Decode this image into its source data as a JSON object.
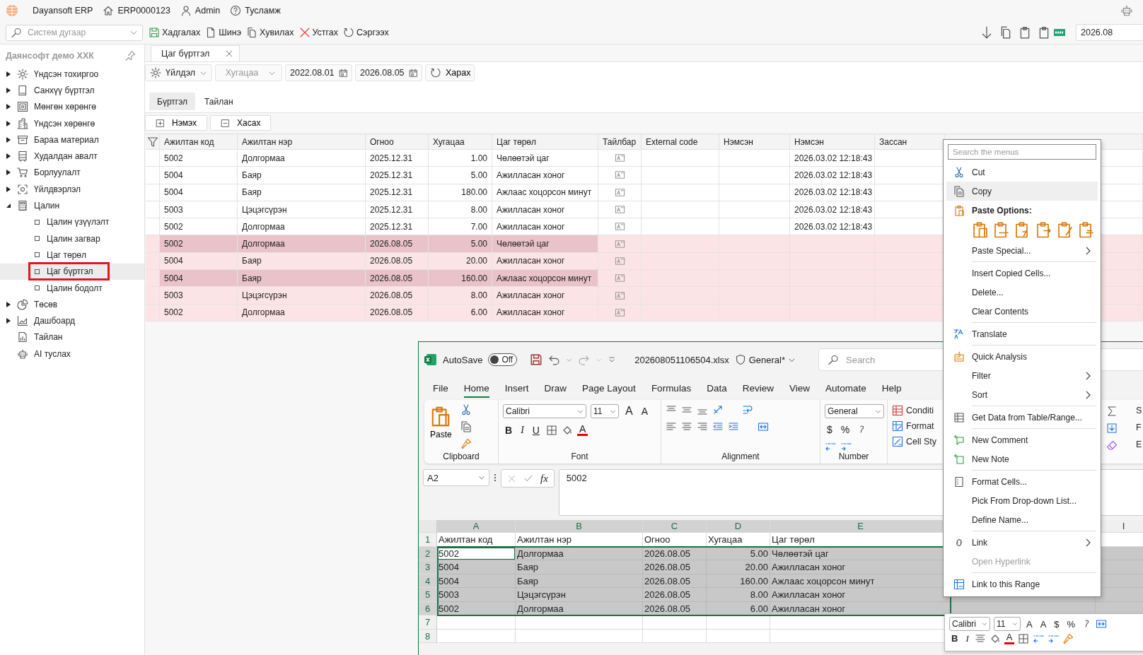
{
  "topbar": {
    "app": "Dayansoft ERP",
    "record": "ERP0000123",
    "user": "Admin",
    "help": "Тусламж"
  },
  "toolbar": {
    "search": {
      "placeholder": "Систем дугаар"
    },
    "actions": [
      {
        "kind": "save",
        "label": "Хадгалах"
      },
      {
        "kind": "new",
        "label": "Шинэ"
      },
      {
        "kind": "duplicate",
        "label": "Хувилах"
      },
      {
        "kind": "delete",
        "label": "Устгах"
      },
      {
        "kind": "restore",
        "label": "Сэргээх"
      }
    ],
    "date": "2026.08"
  },
  "sidebar": {
    "company": "Даянсофт демо ХХК",
    "items": [
      {
        "kind": "gear",
        "label": "Үндсэн тохиргоо",
        "expanded": false
      },
      {
        "kind": "book",
        "label": "Санхүү бүртгэл",
        "expanded": false
      },
      {
        "kind": "safe",
        "label": "Мөнгөн хөрөнгө",
        "expanded": false
      },
      {
        "kind": "building",
        "label": "Үндсэн хөрөнгө",
        "expanded": false
      },
      {
        "kind": "box",
        "label": "Бараа материал",
        "expanded": false
      },
      {
        "kind": "register",
        "label": "Худалдан авалт",
        "expanded": false
      },
      {
        "kind": "cart",
        "label": "Борлуулалт",
        "expanded": false
      },
      {
        "kind": "factory",
        "label": "Үйлдвэрлэл",
        "expanded": false
      },
      {
        "kind": "calculator",
        "label": "Цалин",
        "expanded": true,
        "children": [
          {
            "label": "Цалин үзүүлэлт",
            "selected": false
          },
          {
            "label": "Цалин загвар",
            "selected": false
          },
          {
            "label": "Цаг төрөл",
            "selected": false
          },
          {
            "label": "Цаг бүртгэл",
            "selected": true
          },
          {
            "label": "Цалин бодолт",
            "selected": false
          }
        ]
      },
      {
        "kind": "pie",
        "label": "Төсөв",
        "expanded": false
      },
      {
        "kind": "chart",
        "label": "Дашбоард",
        "expanded": false
      },
      {
        "kind": "report",
        "label": "Тайлан"
      },
      {
        "kind": "robot",
        "label": "AI туслах"
      }
    ]
  },
  "tabs": [
    {
      "label": "Цаг бүртгэл",
      "selected": true
    }
  ],
  "filters": {
    "action": "Үйлдэл",
    "period": {
      "placeholder": "Хугацаа"
    },
    "from": "2022.08.01",
    "to": "2026.08.05",
    "view": "Харах"
  },
  "subtabs": [
    {
      "label": "Бүртгэл",
      "selected": true
    },
    {
      "label": "Тайлан",
      "selected": false
    }
  ],
  "grid_buttons": [
    {
      "kind": "add",
      "label": "Нэмэх"
    },
    {
      "kind": "remove",
      "label": "Хасах"
    }
  ],
  "grid": {
    "columns": [
      "Ажилтан код",
      "Ажилтан нэр",
      "Огноо",
      "Хугацаа",
      "Цаг төрөл",
      "Тайлбар",
      "External code",
      "Нэмсэн",
      "Нэмсэн",
      "Зассан"
    ],
    "rows": [
      {
        "code": "5002",
        "name": "Долгормаа",
        "date": "2025.12.31",
        "hours": "1.00",
        "type": "Чөлөөтэй цаг",
        "added_at": "2026.03.02 12:18:43",
        "unsaved": false,
        "selected": false
      },
      {
        "code": "5004",
        "name": "Баяр",
        "date": "2025.12.31",
        "hours": "5.00",
        "type": "Ажилласан хоног",
        "added_at": "2026.03.02 12:18:43",
        "unsaved": false,
        "selected": false
      },
      {
        "code": "5004",
        "name": "Баяр",
        "date": "2025.12.31",
        "hours": "180.00",
        "type": "Ажлаас хоцорсон минут",
        "added_at": "2026.03.02 12:18:43",
        "unsaved": false,
        "selected": false
      },
      {
        "code": "5003",
        "name": "Цэцэгсүрэн",
        "date": "2025.12.31",
        "hours": "8.00",
        "type": "Ажилласан хоног",
        "added_at": "2026.03.02 12:18:43",
        "unsaved": false,
        "selected": false
      },
      {
        "code": "5002",
        "name": "Долгормаа",
        "date": "2025.12.31",
        "hours": "7.00",
        "type": "Ажилласан хоног",
        "added_at": "2026.03.02 12:18:43",
        "unsaved": false,
        "selected": false
      },
      {
        "code": "5002",
        "name": "Долгормаа",
        "date": "2026.08.05",
        "hours": "5.00",
        "type": "Чөлөөтэй цаг",
        "unsaved": true,
        "selected": true
      },
      {
        "code": "5004",
        "name": "Баяр",
        "date": "2026.08.05",
        "hours": "20.00",
        "type": "Ажилласан хоног",
        "unsaved": true,
        "selected": false
      },
      {
        "code": "5004",
        "name": "Баяр",
        "date": "2026.08.05",
        "hours": "160.00",
        "type": "Ажлаас хоцорсон минут",
        "unsaved": true,
        "selected": true
      },
      {
        "code": "5003",
        "name": "Цэцэгсүрэн",
        "date": "2026.08.05",
        "hours": "8.00",
        "type": "Ажилласан хоног",
        "unsaved": true,
        "selected": false
      },
      {
        "code": "5002",
        "name": "Долгормаа",
        "date": "2026.08.05",
        "hours": "6.00",
        "type": "Ажилласан хоног",
        "unsaved": true,
        "selected": false
      }
    ]
  },
  "excel": {
    "autosave": {
      "label": "AutoSave",
      "on": false,
      "state": "Off"
    },
    "filename": "202608051106504.xlsx",
    "sensitivity": "General*",
    "search": {
      "placeholder": "Search"
    },
    "tabs": [
      {
        "label": "File",
        "selected": false
      },
      {
        "label": "Home",
        "selected": true
      },
      {
        "label": "Insert",
        "selected": false
      },
      {
        "label": "Draw",
        "selected": false
      },
      {
        "label": "Page Layout",
        "selected": false
      },
      {
        "label": "Formulas",
        "selected": false
      },
      {
        "label": "Data",
        "selected": false
      },
      {
        "label": "Review",
        "selected": false
      },
      {
        "label": "View",
        "selected": false
      },
      {
        "label": "Automate",
        "selected": false
      },
      {
        "label": "Help",
        "selected": false
      }
    ],
    "ribbon": {
      "paste": "Paste",
      "font": "Calibri",
      "size": "11",
      "grow": "A",
      "shrink": "A",
      "bold": "B",
      "italic": "I",
      "underline": "U",
      "font_color": "A",
      "number_format": "General",
      "currency": "$",
      "percent": "%",
      "styles": [
        "Conditi",
        "Format",
        "Cell Sty"
      ],
      "editing": [
        "S",
        "F",
        "E"
      ],
      "groups": [
        "Clipboard",
        "Font",
        "Alignment",
        "Number"
      ]
    },
    "name_box": "A2",
    "fx": "fx",
    "formula": "5002",
    "columns": [
      "A",
      "B",
      "C",
      "D",
      "E",
      "I"
    ],
    "rows": [
      {
        "number": "1",
        "cells": [
          "Ажилтан код",
          "Ажилтан нэр",
          "Огноо",
          "Хугацаа",
          "Цаг төрөл"
        ],
        "selected": false,
        "active": false
      },
      {
        "number": "2",
        "cells": [
          "5002",
          "Долгормаа",
          "2026.08.05",
          "5.00",
          "Чөлөөтэй цаг"
        ],
        "selected": true,
        "active": true
      },
      {
        "number": "3",
        "cells": [
          "5004",
          "Баяр",
          "2026.08.05",
          "20.00",
          "Ажилласан хоног"
        ],
        "selected": true,
        "active": false
      },
      {
        "number": "4",
        "cells": [
          "5004",
          "Баяр",
          "2026.08.05",
          "160.00",
          "Ажлаас хоцорсон минут"
        ],
        "selected": true,
        "active": false
      },
      {
        "number": "5",
        "cells": [
          "5003",
          "Цэцэгсүрэн",
          "2026.08.05",
          "8.00",
          "Ажилласан хоног"
        ],
        "selected": true,
        "active": false
      },
      {
        "number": "6",
        "cells": [
          "5002",
          "Долгормаа",
          "2026.08.05",
          "6.00",
          "Ажилласан хоног"
        ],
        "selected": true,
        "active": false
      }
    ],
    "empty_rows": [
      "7",
      "8"
    ]
  },
  "context_menu": {
    "search": {
      "placeholder": "Search the menus"
    },
    "items": [
      {
        "kind": "cut",
        "label": "Cut",
        "submenu": false,
        "disabled": false,
        "selected": false
      },
      {
        "kind": "copy",
        "label": "Copy",
        "submenu": false,
        "disabled": false,
        "selected": true
      },
      {
        "kind": "paste",
        "label": "Paste Options:",
        "submenu": false,
        "disabled": false,
        "selected": false
      },
      {
        "kind": "paste-icons"
      },
      {
        "kind": "plain",
        "label": "Paste Special...",
        "submenu": true,
        "disabled": false,
        "selected": false
      },
      {
        "kind": "separator"
      },
      {
        "kind": "plain",
        "label": "Insert Copied Cells...",
        "submenu": false,
        "disabled": false,
        "selected": false
      },
      {
        "kind": "plain",
        "label": "Delete...",
        "submenu": false,
        "disabled": false,
        "selected": false
      },
      {
        "kind": "plain",
        "label": "Clear Contents",
        "submenu": false,
        "disabled": false,
        "selected": false
      },
      {
        "kind": "separator"
      },
      {
        "kind": "translate",
        "label": "Translate",
        "submenu": false,
        "disabled": false,
        "selected": false
      },
      {
        "kind": "separator"
      },
      {
        "kind": "quick",
        "label": "Quick Analysis",
        "submenu": false,
        "disabled": false,
        "selected": false
      },
      {
        "kind": "plain",
        "label": "Filter",
        "submenu": true,
        "disabled": false,
        "selected": false
      },
      {
        "kind": "plain",
        "label": "Sort",
        "submenu": true,
        "disabled": false,
        "selected": false
      },
      {
        "kind": "separator"
      },
      {
        "kind": "table",
        "label": "Get Data from Table/Range...",
        "submenu": false,
        "disabled": false,
        "selected": false
      },
      {
        "kind": "separator"
      },
      {
        "kind": "comment",
        "label": "New Comment",
        "submenu": false,
        "disabled": false,
        "selected": false
      },
      {
        "kind": "note",
        "label": "New Note",
        "submenu": false,
        "disabled": false,
        "selected": false
      },
      {
        "kind": "separator"
      },
      {
        "kind": "format",
        "label": "Format Cells...",
        "submenu": false,
        "disabled": false,
        "selected": false
      },
      {
        "kind": "plain",
        "label": "Pick From Drop-down List...",
        "submenu": false,
        "disabled": false,
        "selected": false
      },
      {
        "kind": "plain",
        "label": "Define Name...",
        "submenu": false,
        "disabled": false,
        "selected": false
      },
      {
        "kind": "separator"
      },
      {
        "kind": "link",
        "label": "Link",
        "submenu": true,
        "disabled": false,
        "selected": false
      },
      {
        "kind": "plain",
        "label": "Open Hyperlink",
        "submenu": false,
        "disabled": true,
        "selected": false
      },
      {
        "kind": "separator"
      },
      {
        "kind": "linkrange",
        "label": "Link to this Range",
        "submenu": false,
        "disabled": false,
        "selected": false
      }
    ]
  },
  "mini_toolbar": {
    "font": "Calibri",
    "size": "11",
    "grow": "A",
    "shrink": "A",
    "currency": "$",
    "percent": "%",
    "bold": "B",
    "italic": "I",
    "font_color": "A"
  }
}
